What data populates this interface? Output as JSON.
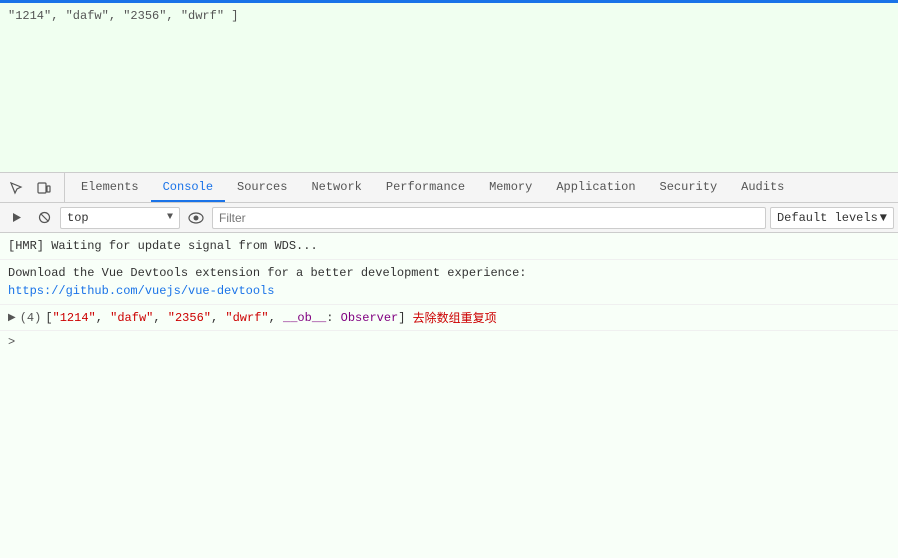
{
  "topBorder": {
    "color": "#1a73e8"
  },
  "codeArea": {
    "line": "\"1214\", \"dafw\", \"2356\", \"dwrf\" ]"
  },
  "toolbar": {
    "icons": [
      {
        "name": "cursor-icon",
        "symbol": "↖",
        "title": "Select element"
      },
      {
        "name": "device-icon",
        "symbol": "⬜",
        "title": "Device toolbar"
      }
    ],
    "tabs": [
      {
        "id": "elements",
        "label": "Elements",
        "active": false
      },
      {
        "id": "console",
        "label": "Console",
        "active": true
      },
      {
        "id": "sources",
        "label": "Sources",
        "active": false
      },
      {
        "id": "network",
        "label": "Network",
        "active": false
      },
      {
        "id": "performance",
        "label": "Performance",
        "active": false
      },
      {
        "id": "memory",
        "label": "Memory",
        "active": false
      },
      {
        "id": "application",
        "label": "Application",
        "active": false
      },
      {
        "id": "security",
        "label": "Security",
        "active": false
      },
      {
        "id": "audits",
        "label": "Audits",
        "active": false
      }
    ]
  },
  "consoleToolbar": {
    "playIcon": "▶",
    "blockIcon": "⊘",
    "topLabel": "top",
    "dropdownArrow": "▼",
    "eyeSymbol": "👁",
    "filterPlaceholder": "Filter",
    "defaultLevels": "Default levels",
    "dropdownArrow2": "▼"
  },
  "consoleMessages": [
    {
      "type": "hmr",
      "text": "[HMR] Waiting for update signal from WDS..."
    },
    {
      "type": "info",
      "text": "Download the Vue Devtools extension for a better development experience:",
      "link": "https://github.com/vuejs/vue-devtools"
    }
  ],
  "arrayLine": {
    "arrow": "▶",
    "count": "(4)",
    "bracket": "[",
    "items": [
      {
        "val": "\"1214\"",
        "type": "string"
      },
      {
        "val": "\"dafw\"",
        "type": "string"
      },
      {
        "val": "\"2356\"",
        "type": "string"
      },
      {
        "val": "\"dwrf\"",
        "type": "string"
      },
      {
        "val": "__ob__",
        "type": "key"
      },
      {
        "val": ": Observer]",
        "type": "observer"
      }
    ],
    "chineseText": "去除数组重复项"
  },
  "promptSymbol": ">"
}
